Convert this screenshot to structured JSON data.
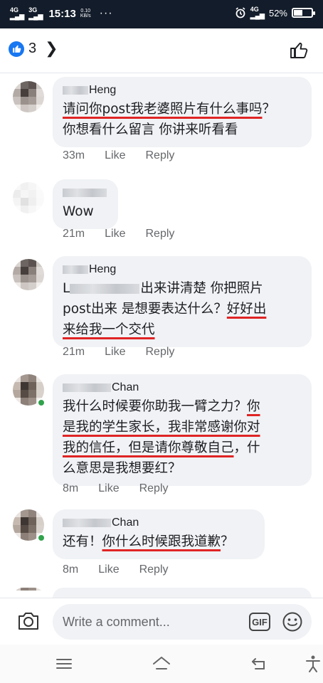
{
  "status_bar": {
    "network_1": "4G",
    "network_2": "3G",
    "time": "15:13",
    "speed_value": "0.10",
    "speed_unit": "KB/s",
    "menu": "···",
    "network_right": "4G",
    "battery": "52%",
    "battery_level": 0.52
  },
  "header": {
    "reaction_count": "3",
    "icon_like": "like-icon",
    "icon_more": "chevron-right-icon",
    "icon_thumb": "thumbs-up-icon"
  },
  "comments": [
    {
      "name": "Heng",
      "text_parts": [
        {
          "text": "请问你post我老婆照片有什么事吗",
          "underline": true
        },
        {
          "text": "？\n你想看什么留言 你讲来听看看",
          "underline": false
        }
      ],
      "time": "33m",
      "like": "Like",
      "reply": "Reply",
      "online": false
    },
    {
      "name": "",
      "text_parts": [
        {
          "text": "Wow",
          "underline": false
        }
      ],
      "time": "21m",
      "like": "Like",
      "reply": "Reply",
      "online": false
    },
    {
      "name": "Heng",
      "text_parts": [
        {
          "text": "L",
          "underline": false
        },
        {
          "text": "出来讲清楚 你把照片\npost出来 是想要表达什么？",
          "underline": false
        },
        {
          "text": "好好出\n来给我一个交代",
          "underline": true
        }
      ],
      "time": "21m",
      "like": "Like",
      "reply": "Reply",
      "online": false
    },
    {
      "name": "Chan",
      "text_parts": [
        {
          "text": "我什么时候要你助我一臂之力？",
          "underline": false
        },
        {
          "text": "你\n是我的学生家长，我非常感谢你对\n我的信任，但是请你尊敬自己",
          "underline": true
        },
        {
          "text": "，什\n么意思是我想要红？",
          "underline": false
        }
      ],
      "time": "8m",
      "like": "Like",
      "reply": "Reply",
      "online": true
    },
    {
      "name": "Chan",
      "text_parts": [
        {
          "text": "还有！",
          "underline": false
        },
        {
          "text": "你什么时候跟我道歉",
          "underline": true
        },
        {
          "text": "？",
          "underline": false
        }
      ],
      "time": "8m",
      "like": "Like",
      "reply": "Reply",
      "online": true
    }
  ],
  "composer": {
    "placeholder": "Write a comment...",
    "gif_label": "GIF",
    "icon_camera": "camera-icon",
    "icon_emoji": "emoji-icon"
  },
  "nav": {
    "icon_menu": "menu-icon",
    "icon_home": "home-icon",
    "icon_back": "back-icon",
    "icon_accessibility": "accessibility-icon"
  },
  "colors": {
    "status_bar": "#131c2a",
    "bubble": "#f0f2f5",
    "meta_text": "#65676b",
    "underline": "#e02424",
    "like_blue": "#1877f2",
    "online": "#31a24c"
  }
}
